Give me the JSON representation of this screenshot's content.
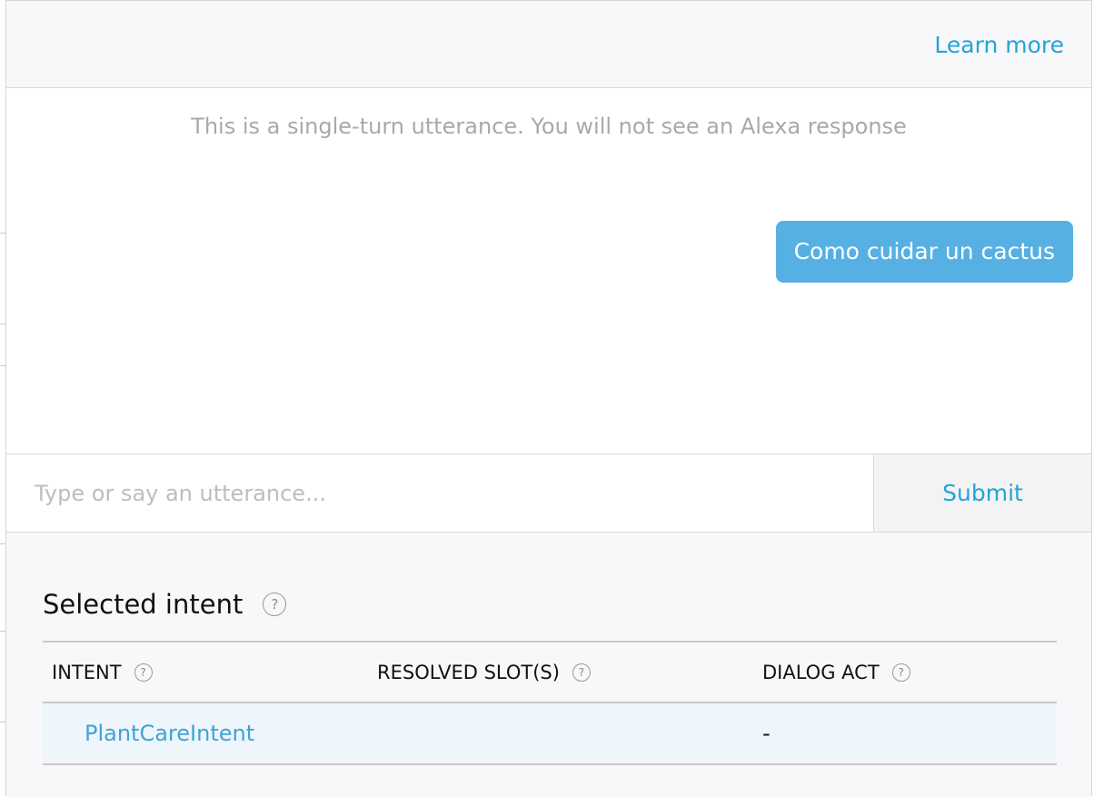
{
  "header": {
    "learn_more": "Learn more"
  },
  "conversation": {
    "notice": "This is a single-turn utterance. You will not see an Alexa response",
    "user_utterance": "Como cuidar un cactus"
  },
  "input": {
    "placeholder": "Type or say an utterance...",
    "value": "",
    "submit_label": "Submit"
  },
  "selected_intent": {
    "title": "Selected intent",
    "help_glyph": "?",
    "columns": [
      {
        "label": "INTENT"
      },
      {
        "label": "RESOLVED SLOT(S)"
      },
      {
        "label": "DIALOG ACT"
      }
    ],
    "rows": [
      {
        "intent": "PlantCareIntent",
        "resolved_slots": "",
        "dialog_act": "-"
      }
    ]
  },
  "colors": {
    "accent": "#23a4d8",
    "bubble": "#56b0e3",
    "row_highlight": "#eef5fb"
  }
}
